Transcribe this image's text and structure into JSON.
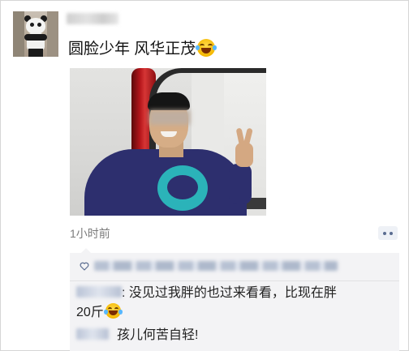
{
  "post": {
    "text": "圆脸少年 风华正茂",
    "text_emoji": "grinning-sweat-emoji",
    "time": "1小时前"
  },
  "comments": [
    {
      "text_line1": ": 没见过我胖的也过来看看，比现在胖",
      "text_line2": "20斤",
      "emoji": "grinning-sweat-emoji"
    },
    {
      "text": "孩儿何苦自轻!"
    }
  ],
  "colors": {
    "time_text": "#7b7b7b",
    "panel_bg": "#f3f3f5",
    "link_blue": "#5a6c90"
  },
  "icons": {
    "more": "more-dots-icon",
    "like": "heart-outline-icon"
  }
}
